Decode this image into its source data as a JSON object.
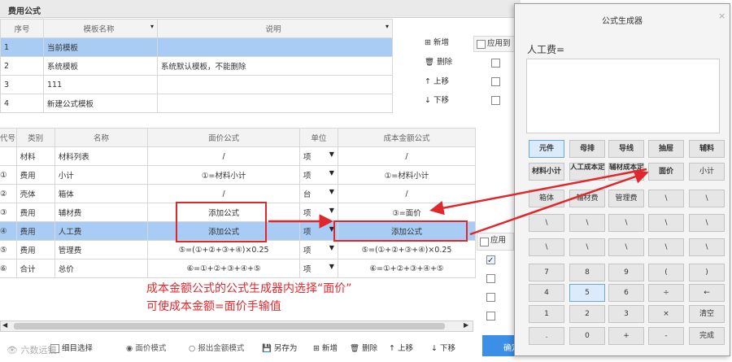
{
  "dialog": {
    "title": "费用公式"
  },
  "tmpl": {
    "headers": [
      "序号",
      "模板名称",
      "说明"
    ],
    "rows": [
      {
        "no": "1",
        "name": "当前模板",
        "desc": ""
      },
      {
        "no": "2",
        "name": "系统模板",
        "desc": "系统默认模板，不能删除"
      },
      {
        "no": "3",
        "name": "111",
        "desc": ""
      },
      {
        "no": "4",
        "name": "新建公式模板",
        "desc": ""
      }
    ],
    "actions": {
      "add": "新增",
      "del": "删除",
      "up": "上移",
      "down": "下移"
    }
  },
  "apply": {
    "label": "应用到",
    "label2": "应用"
  },
  "items": {
    "headers": [
      "代号",
      "类别",
      "名称",
      "面价公式",
      "单位",
      "成本金额公式"
    ],
    "rows": [
      {
        "code": "",
        "cat": "材料",
        "name": "材料列表",
        "price": "/",
        "unit": "项",
        "cost": "/"
      },
      {
        "code": "①",
        "cat": "费用",
        "name": "小计",
        "price": "①=材料小计",
        "unit": "项",
        "cost": "①=材料小计"
      },
      {
        "code": "②",
        "cat": "壳体",
        "name": "箱体",
        "price": "/",
        "unit": "台",
        "cost": "/"
      },
      {
        "code": "③",
        "cat": "费用",
        "name": "辅材费",
        "price": "添加公式",
        "unit": "项",
        "cost": "③=面价"
      },
      {
        "code": "④",
        "cat": "费用",
        "name": "人工费",
        "price": "添加公式",
        "unit": "项",
        "cost": "添加公式"
      },
      {
        "code": "⑤",
        "cat": "费用",
        "name": "管理费",
        "price": "⑤=(①+②+③+④)×0.25",
        "unit": "项",
        "cost": "⑤=(①+②+③+④)×0.25"
      },
      {
        "code": "⑥",
        "cat": "合计",
        "name": "总价",
        "price": "⑥=①+②+③+④+⑤",
        "unit": "项",
        "cost": "⑥=①+②+③+④+⑤"
      }
    ]
  },
  "annotation": {
    "line1": "成本金额公式的公式生成器内选择“面价”",
    "line2": "可使成本金额=面价手输值"
  },
  "bottom": {
    "check": "细目选择",
    "mode1": "面价模式",
    "mode2": "报出金额模式",
    "saveas": "另存为",
    "add": "新增",
    "del": "删除",
    "up": "上移",
    "down": "下移",
    "confirm": "确定"
  },
  "watermark": "六数远镜",
  "gen": {
    "title": "公式生成器",
    "close": "×",
    "formula": "人工费=",
    "keys": [
      [
        "元件",
        "母排",
        "导线",
        "抽屉",
        "辅料"
      ],
      [
        "材料小计",
        "人工成本定额",
        "辅材成本定额",
        "面价",
        "小计"
      ],
      [
        "箱体",
        "辅材费",
        "管理费",
        "\\",
        "\\"
      ],
      [
        "\\",
        "\\",
        "\\",
        "\\",
        "\\"
      ],
      [
        "\\",
        "\\",
        "\\",
        "\\",
        "\\"
      ],
      [
        "7",
        "8",
        "9",
        "(",
        ")"
      ],
      [
        "4",
        "5",
        "6",
        "÷",
        "←"
      ],
      [
        "1",
        "2",
        "3",
        "×",
        "清空"
      ],
      [
        ".",
        "0",
        "+",
        "-",
        "完成"
      ]
    ]
  }
}
